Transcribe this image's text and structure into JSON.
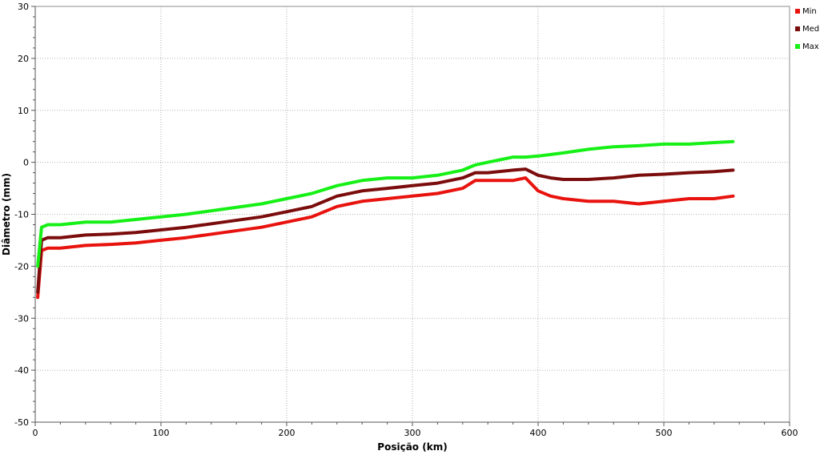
{
  "chart_data": {
    "type": "line",
    "title": "",
    "xlabel": "Posição (km)",
    "ylabel": "Diâmetro (mm)",
    "xlim": [
      0,
      600
    ],
    "ylim": [
      -50,
      30
    ],
    "x_ticks": [
      0,
      100,
      200,
      300,
      400,
      500,
      600
    ],
    "y_ticks": [
      -50,
      -40,
      -30,
      -20,
      -10,
      0,
      10,
      20,
      30
    ],
    "grid": true,
    "legend_position": "top-right",
    "series": [
      {
        "name": "Min",
        "color": "#e8130e",
        "x": [
          2,
          5,
          10,
          20,
          40,
          60,
          80,
          100,
          120,
          150,
          180,
          200,
          220,
          240,
          260,
          280,
          300,
          320,
          340,
          350,
          360,
          380,
          390,
          400,
          410,
          420,
          440,
          460,
          480,
          500,
          520,
          540,
          555
        ],
        "y": [
          -26,
          -17,
          -16.5,
          -16.5,
          -16,
          -15.8,
          -15.5,
          -15,
          -14.5,
          -13.5,
          -12.5,
          -11.5,
          -10.5,
          -8.5,
          -7.5,
          -7,
          -6.5,
          -6,
          -5,
          -3.5,
          -3.5,
          -3.5,
          -3,
          -5.5,
          -6.5,
          -7,
          -7.5,
          -7.5,
          -8,
          -7.5,
          -7,
          -7,
          -6.5
        ]
      },
      {
        "name": "Med",
        "color": "#7b0c0c",
        "x": [
          2,
          5,
          10,
          20,
          40,
          60,
          80,
          100,
          120,
          150,
          180,
          200,
          220,
          240,
          260,
          280,
          300,
          320,
          340,
          350,
          360,
          380,
          390,
          400,
          410,
          420,
          440,
          460,
          480,
          500,
          520,
          540,
          555
        ],
        "y": [
          -25,
          -15,
          -14.5,
          -14.5,
          -14,
          -13.8,
          -13.5,
          -13,
          -12.5,
          -11.5,
          -10.5,
          -9.5,
          -8.5,
          -6.5,
          -5.5,
          -5,
          -4.5,
          -4,
          -3,
          -2,
          -2,
          -1.5,
          -1.3,
          -2.5,
          -3,
          -3.3,
          -3.3,
          -3,
          -2.5,
          -2.3,
          -2,
          -1.8,
          -1.5
        ]
      },
      {
        "name": "Max",
        "color": "#16f016",
        "x": [
          2,
          5,
          10,
          20,
          40,
          60,
          80,
          100,
          120,
          150,
          180,
          200,
          220,
          240,
          260,
          280,
          300,
          320,
          340,
          350,
          360,
          380,
          390,
          400,
          410,
          420,
          440,
          460,
          480,
          500,
          520,
          540,
          555
        ],
        "y": [
          -20,
          -12.5,
          -12,
          -12,
          -11.5,
          -11.5,
          -11,
          -10.5,
          -10,
          -9,
          -8,
          -7,
          -6,
          -4.5,
          -3.5,
          -3,
          -3,
          -2.5,
          -1.5,
          -0.5,
          0,
          1,
          1,
          1.2,
          1.5,
          1.8,
          2.5,
          3,
          3.2,
          3.5,
          3.5,
          3.8,
          4
        ]
      }
    ]
  }
}
